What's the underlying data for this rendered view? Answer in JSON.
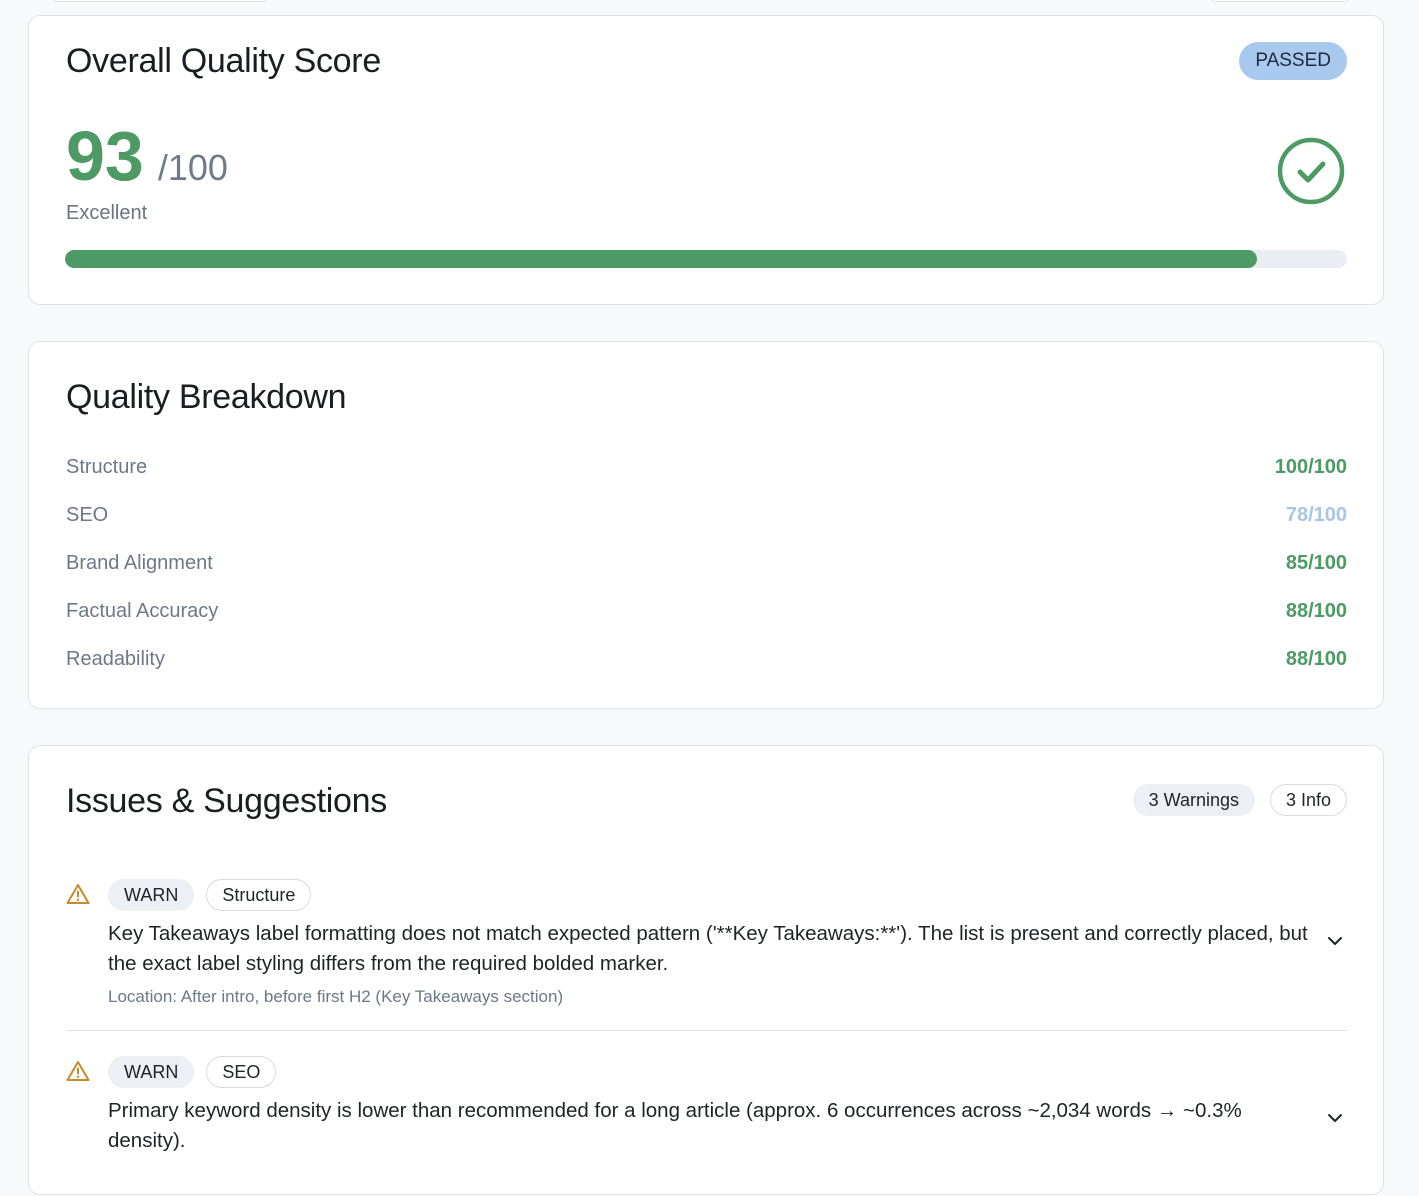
{
  "overall": {
    "title": "Overall Quality Score",
    "status": "PASSED",
    "score": "93",
    "max": "/100",
    "rating": "Excellent",
    "progress_fraction": 0.93,
    "check_icon": "check-circle-icon",
    "accent": "#4d9a64"
  },
  "breakdown": {
    "title": "Quality Breakdown",
    "rows": [
      {
        "name": "Structure",
        "score": "100/100",
        "color": "#4d9a64"
      },
      {
        "name": "SEO",
        "score": "78/100",
        "color": "#a9c5e6"
      },
      {
        "name": "Brand Alignment",
        "score": "85/100",
        "color": "#4d9a64"
      },
      {
        "name": "Factual Accuracy",
        "score": "88/100",
        "color": "#4d9a64"
      },
      {
        "name": "Readability",
        "score": "88/100",
        "color": "#4d9a64"
      }
    ]
  },
  "issues": {
    "title": "Issues & Suggestions",
    "warnings_count": "3 Warnings",
    "info_count": "3 Info",
    "items": [
      {
        "icon": "warning-triangle-icon",
        "severity": "WARN",
        "category": "Structure",
        "message": "Key Takeaways label formatting does not match expected pattern ('**Key Takeaways:**'). The list is present and correctly placed, but the exact label styling differs from the required bolded marker.",
        "location": "Location: After intro, before first H2 (Key Takeaways section)"
      },
      {
        "icon": "warning-triangle-icon",
        "severity": "WARN",
        "category": "SEO",
        "message": "Primary keyword density is lower than recommended for a long article (approx. 6 occurrences across ~2,034 words → ~0.3% density).",
        "location": ""
      }
    ]
  }
}
